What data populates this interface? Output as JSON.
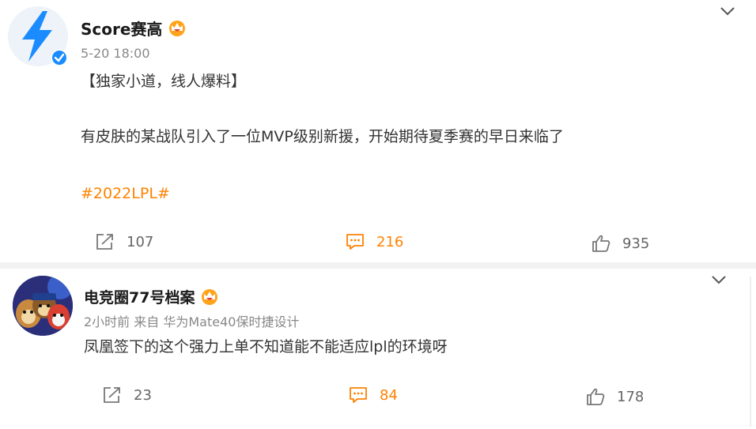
{
  "post": {
    "author": "Score赛高",
    "time": "5-20 18:00",
    "line1": "【独家小道，线人爆料】",
    "line2": "有皮肤的某战队引入了一位MVP级别新援，开始期待夏季赛的早日来临了",
    "hashtag": "#2022LPL#",
    "reposts": "107",
    "comments": "216",
    "likes": "935",
    "icons": {
      "repost": "share-icon",
      "comment": "comment-icon",
      "like": "thumbs-up-icon",
      "more": "chevron-down-icon",
      "verified": "verified-icon",
      "badge": "crown-badge-icon"
    },
    "colors": {
      "accent": "#ff8200",
      "avatar_bg": "#eef3f9",
      "bolt": "#1a8cff"
    }
  },
  "comment": {
    "author": "电竞圈77号档案",
    "meta": "2小时前 来自 华为Mate40保时捷设计",
    "text": "凤凰签下的这个强力上单不知道能不能适应lpl的环境呀",
    "reposts": "23",
    "comments": "84",
    "likes": "178",
    "icons": {
      "repost": "share-icon",
      "comment": "comment-icon",
      "like": "thumbs-up-icon",
      "more": "chevron-down-icon",
      "badge": "crown-badge-icon"
    }
  }
}
